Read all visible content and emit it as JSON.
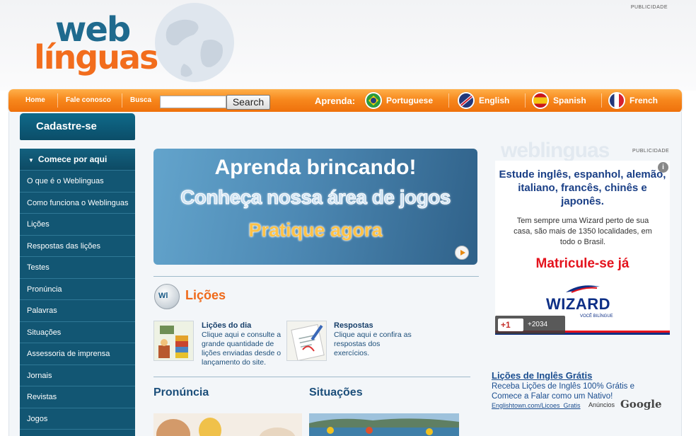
{
  "header": {
    "logo_line1": "web",
    "logo_line2": "línguas",
    "publicidade": "PUBLICIDADE"
  },
  "navbar": {
    "links": [
      "Home",
      "Fale conosco",
      "Busca"
    ],
    "search_value": "",
    "search_button": "Search",
    "aprenda_label": "Aprenda:",
    "languages": [
      "Portuguese",
      "English",
      "Spanish",
      "French"
    ]
  },
  "sidebar": {
    "cadastre": "Cadastre-se",
    "header": "Comece por aqui",
    "items": [
      "O que é o Weblinguas",
      "Como funciona o Weblinguas",
      "Lições",
      "Respostas das lições",
      "Testes",
      "Pronúncia",
      "Palavras",
      "Situações",
      "Assessoria de imprensa",
      "Jornais",
      "Revistas",
      "Jogos"
    ]
  },
  "banner": {
    "line1": "Aprenda brincando!",
    "line2": "Conheça nossa área de jogos",
    "line3": "Pratique agora"
  },
  "licoes": {
    "icon_text": "Wl",
    "title": "Lições",
    "items": [
      {
        "title": "Lições do dia",
        "desc": "Clique aqui e consulte a grande quantidade de lições enviadas desde o lançamento do site."
      },
      {
        "title": "Respostas",
        "desc": "Clique aqui e confira as respostas dos exercícios."
      }
    ]
  },
  "sections": [
    "Pronúncia",
    "Situações"
  ],
  "ad": {
    "publicidade": "PUBLICIDADE",
    "watermark": "weblinguas",
    "info": "i",
    "headline": "Estude inglês, espanhol, alemão, italiano, francês, chinês e japonês.",
    "body": "Tem sempre uma Wizard perto de sua casa, são mais de 1350 localidades, em todo o Brasil.",
    "cta": "Matricule-se já",
    "brand": "WIZARD",
    "tagline": "VOCÊ BILÍNGUE",
    "gplus": "+1",
    "gplus_count": "+2034"
  },
  "text_ad": {
    "title": "Lições de Inglês Grátis",
    "text": "Receba Lições de Inglês 100% Grátis e Comece a Falar como um Nativo!",
    "url": "Englishtown.com/Licoes_Gratis",
    "anuncios": "Anúncios",
    "google": "Google"
  },
  "colors": {
    "nav_orange": "#f7881d",
    "sidebar_blue": "#125673",
    "logo_blue": "#1f6a8e",
    "logo_orange": "#f26d1d",
    "accent_orange": "#ef6a1a",
    "wizard_red": "#e4131d"
  }
}
